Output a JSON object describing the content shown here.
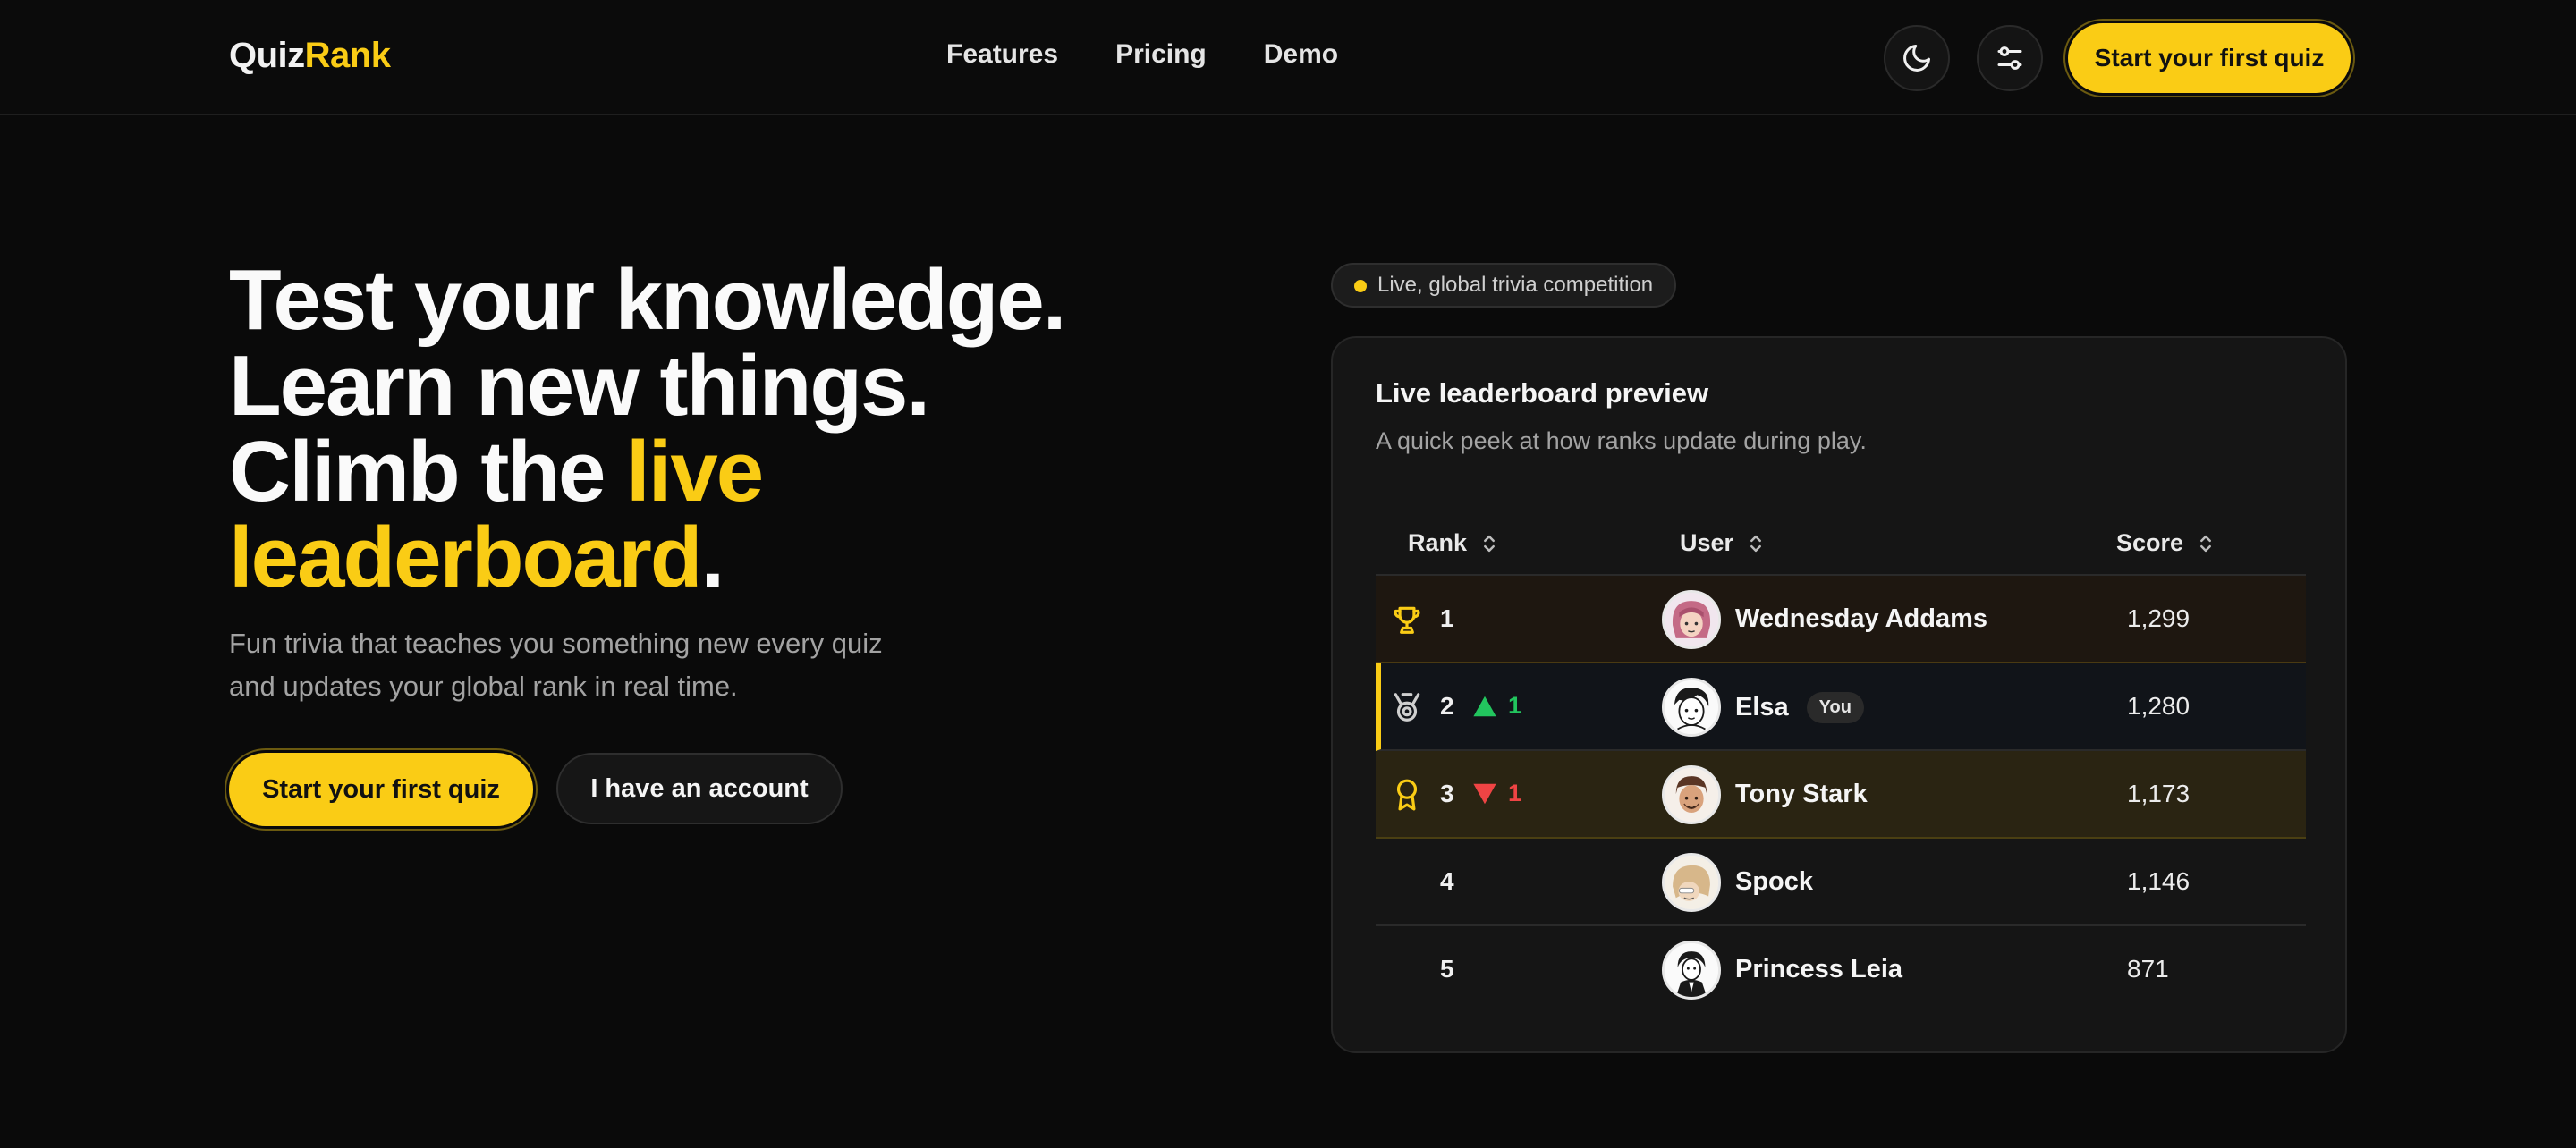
{
  "header": {
    "logo_part1": "Quiz",
    "logo_part2": "Rank",
    "nav": [
      "Features",
      "Pricing",
      "Demo"
    ],
    "cta": "Start your first quiz",
    "theme_icon": "moon-icon",
    "settings_icon": "sliders-icon"
  },
  "hero": {
    "line1": "Test your knowledge.",
    "line2": "Learn new things.",
    "line3_prefix": "Climb the ",
    "line3_accent": "live",
    "line4_accent": "leaderboard",
    "line4_suffix": ".",
    "subtitle": "Fun trivia that teaches you something new every quiz and updates your global rank in real time.",
    "primary_button": "Start your first quiz",
    "secondary_button": "I have an account"
  },
  "badge": {
    "label": "Live, global trivia competition"
  },
  "leaderboard": {
    "title": "Live leaderboard preview",
    "subtitle": "A quick peek at how ranks update during play.",
    "columns": [
      "Rank",
      "User",
      "Score"
    ],
    "rows": [
      {
        "rank": "1",
        "medal": "trophy-icon",
        "delta": "",
        "name": "Wednesday Addams",
        "you": "",
        "score": "1,299"
      },
      {
        "rank": "2",
        "medal": "silver-medal-icon",
        "delta": "1",
        "delta_dir": "up",
        "name": "Elsa",
        "you": "You",
        "score": "1,280"
      },
      {
        "rank": "3",
        "medal": "bronze-award-icon",
        "delta": "1",
        "delta_dir": "down",
        "name": "Tony Stark",
        "you": "",
        "score": "1,173"
      },
      {
        "rank": "4",
        "medal": "",
        "delta": "",
        "name": "Spock",
        "you": "",
        "score": "1,146"
      },
      {
        "rank": "5",
        "medal": "",
        "delta": "",
        "name": "Princess Leia",
        "you": "",
        "score": "871"
      }
    ]
  },
  "colors": {
    "background": "#0a0a0a",
    "accent": "#facc15",
    "up": "#22c55e",
    "down": "#ef4444"
  }
}
